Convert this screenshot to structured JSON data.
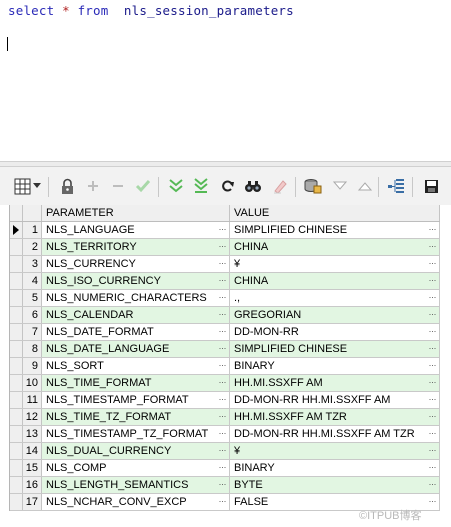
{
  "editor": {
    "kw_select": "select",
    "op_star": "*",
    "kw_from": "from",
    "table": "nls_session_parameters"
  },
  "toolbar": {
    "icons": [
      "grid-view-icon",
      "grid-dropdown-icon",
      "lock-icon",
      "add-record-icon",
      "delete-record-icon",
      "post-changes-icon",
      "next-page-icon",
      "last-page-icon",
      "refresh-icon",
      "find-icon",
      "clear-icon",
      "export-icon",
      "filter-down-icon",
      "filter-up-icon",
      "tree-view-icon",
      "save-icon"
    ]
  },
  "grid": {
    "columns": [
      "PARAMETER",
      "VALUE"
    ],
    "cell_button": "···",
    "rows": [
      {
        "num": "1",
        "parameter": "NLS_LANGUAGE",
        "value": "SIMPLIFIED CHINESE"
      },
      {
        "num": "2",
        "parameter": "NLS_TERRITORY",
        "value": "CHINA"
      },
      {
        "num": "3",
        "parameter": "NLS_CURRENCY",
        "value": "¥"
      },
      {
        "num": "4",
        "parameter": "NLS_ISO_CURRENCY",
        "value": "CHINA"
      },
      {
        "num": "5",
        "parameter": "NLS_NUMERIC_CHARACTERS",
        "value": ".,"
      },
      {
        "num": "6",
        "parameter": "NLS_CALENDAR",
        "value": "GREGORIAN"
      },
      {
        "num": "7",
        "parameter": "NLS_DATE_FORMAT",
        "value": "DD-MON-RR"
      },
      {
        "num": "8",
        "parameter": "NLS_DATE_LANGUAGE",
        "value": "SIMPLIFIED CHINESE"
      },
      {
        "num": "9",
        "parameter": "NLS_SORT",
        "value": "BINARY"
      },
      {
        "num": "10",
        "parameter": "NLS_TIME_FORMAT",
        "value": "HH.MI.SSXFF AM"
      },
      {
        "num": "11",
        "parameter": "NLS_TIMESTAMP_FORMAT",
        "value": "DD-MON-RR HH.MI.SSXFF AM"
      },
      {
        "num": "12",
        "parameter": "NLS_TIME_TZ_FORMAT",
        "value": "HH.MI.SSXFF AM TZR"
      },
      {
        "num": "13",
        "parameter": "NLS_TIMESTAMP_TZ_FORMAT",
        "value": "DD-MON-RR HH.MI.SSXFF AM TZR"
      },
      {
        "num": "14",
        "parameter": "NLS_DUAL_CURRENCY",
        "value": "¥"
      },
      {
        "num": "15",
        "parameter": "NLS_COMP",
        "value": "BINARY"
      },
      {
        "num": "16",
        "parameter": "NLS_LENGTH_SEMANTICS",
        "value": "BYTE"
      },
      {
        "num": "17",
        "parameter": "NLS_NCHAR_CONV_EXCP",
        "value": "FALSE"
      }
    ]
  },
  "watermark": "©ITPUB博客"
}
